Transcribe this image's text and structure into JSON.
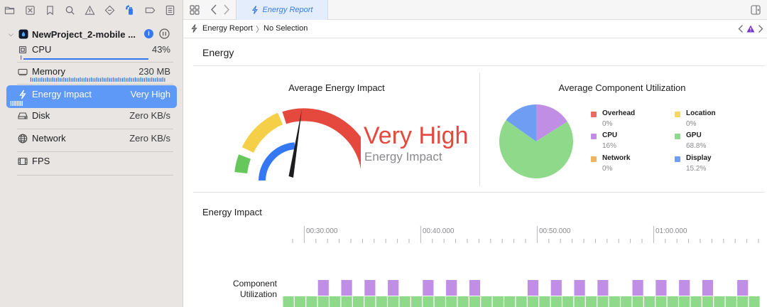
{
  "sidebar": {
    "toolbar_icons": [
      "folder-icon",
      "xcode-close-square-icon",
      "bookmark-icon",
      "search-icon",
      "warning-triangle-icon",
      "test-diamond-icon",
      "debug-spray-icon",
      "breakpoint-icon",
      "report-list-icon"
    ],
    "project": {
      "name": "NewProject_2-mobile ..."
    },
    "gauges": [
      {
        "id": "cpu",
        "icon": "cpu-chip-icon",
        "label": "CPU",
        "value": "43%",
        "selected": false
      },
      {
        "id": "memory",
        "icon": "memory-card-icon",
        "label": "Memory",
        "value": "230 MB",
        "selected": false
      },
      {
        "id": "energy",
        "icon": "lightning-bolt-icon",
        "label": "Energy Impact",
        "value": "Very High",
        "selected": true
      },
      {
        "id": "disk",
        "icon": "disk-drive-icon",
        "label": "Disk",
        "value": "Zero KB/s",
        "selected": false
      },
      {
        "id": "network",
        "icon": "globe-icon",
        "label": "Network",
        "value": "Zero KB/s",
        "selected": false
      },
      {
        "id": "fps",
        "icon": "film-icon",
        "label": "FPS",
        "value": "",
        "selected": false
      }
    ]
  },
  "tab": {
    "label": "Energy Report"
  },
  "jump_bar": {
    "crumb1": "Energy Report",
    "separator": "〉",
    "crumb2": "No Selection"
  },
  "report": {
    "section_title": "Energy",
    "avg_energy_title": "Average Energy Impact",
    "status": "Very High",
    "status_sub": "Energy Impact",
    "avg_component_title": "Average Component Utilization",
    "timeline_title": "Energy Impact",
    "lane_label_line1": "Component",
    "lane_label_line2": "Utilization",
    "timeline_ticks": [
      "00:30.000",
      "00:40.000",
      "00:50.000",
      "01:00.000"
    ]
  },
  "colors": {
    "overhead": "#e86c64",
    "cpu": "#c18ee6",
    "network": "#f3b45e",
    "location": "#f6d765",
    "gpu": "#8fd98b",
    "display": "#6f9df4",
    "gauge_red": "#e5483d",
    "selection": "#5f99f7"
  },
  "chart_data": {
    "type": "pie",
    "title": "Average Component Utilization",
    "series": [
      {
        "name": "Overhead",
        "value": 0,
        "label": "0%",
        "color": "#e86c64"
      },
      {
        "name": "Location",
        "value": 0,
        "label": "0%",
        "color": "#f6d765"
      },
      {
        "name": "CPU",
        "value": 16,
        "label": "16%",
        "color": "#c18ee6"
      },
      {
        "name": "GPU",
        "value": 68.8,
        "label": "68.8%",
        "color": "#8fd98b"
      },
      {
        "name": "Network",
        "value": 0,
        "label": "0%",
        "color": "#f3b45e"
      },
      {
        "name": "Display",
        "value": 15.2,
        "label": "15.2%",
        "color": "#6f9df4"
      }
    ]
  }
}
